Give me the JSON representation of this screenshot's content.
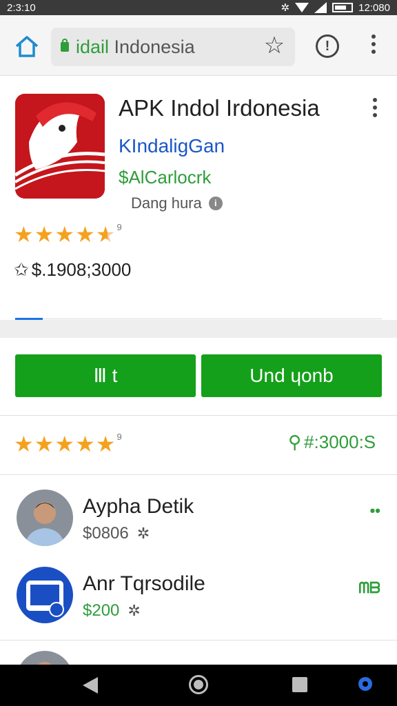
{
  "status_bar": {
    "time": "2:3:10",
    "battery_text": "12:080"
  },
  "browser": {
    "url_domain": "idail",
    "url_rest": " Indonesia",
    "icons": [
      "home-icon",
      "lock-icon",
      "star-icon",
      "alert-icon",
      "more-vert-icon"
    ]
  },
  "app": {
    "title": "APK Indol Irdonesia",
    "developer": "KIndaligGan",
    "price_line": "$AlCarlocrk",
    "status": "Dang hura",
    "rating_count": "9",
    "downloads": "$.1908;3000",
    "brand_color": "#c4161c"
  },
  "actions": {
    "left_label": "Ⅲ t",
    "right_label": "Und ɥonb",
    "button_color": "#14a01a"
  },
  "stats": {
    "rating_count": "9",
    "right_value": "#:3000:S"
  },
  "list": [
    {
      "name": "Ayрha Detik",
      "sub": "$0806",
      "action": "••",
      "sub_color": "gray"
    },
    {
      "name": "Anr Tqrsodile",
      "sub": "$200",
      "action": "ᗰᗷ",
      "sub_color": "green"
    }
  ],
  "navbar": {
    "icons": [
      "back-icon",
      "home-circle-icon",
      "recents-icon",
      "assistant-icon"
    ]
  }
}
